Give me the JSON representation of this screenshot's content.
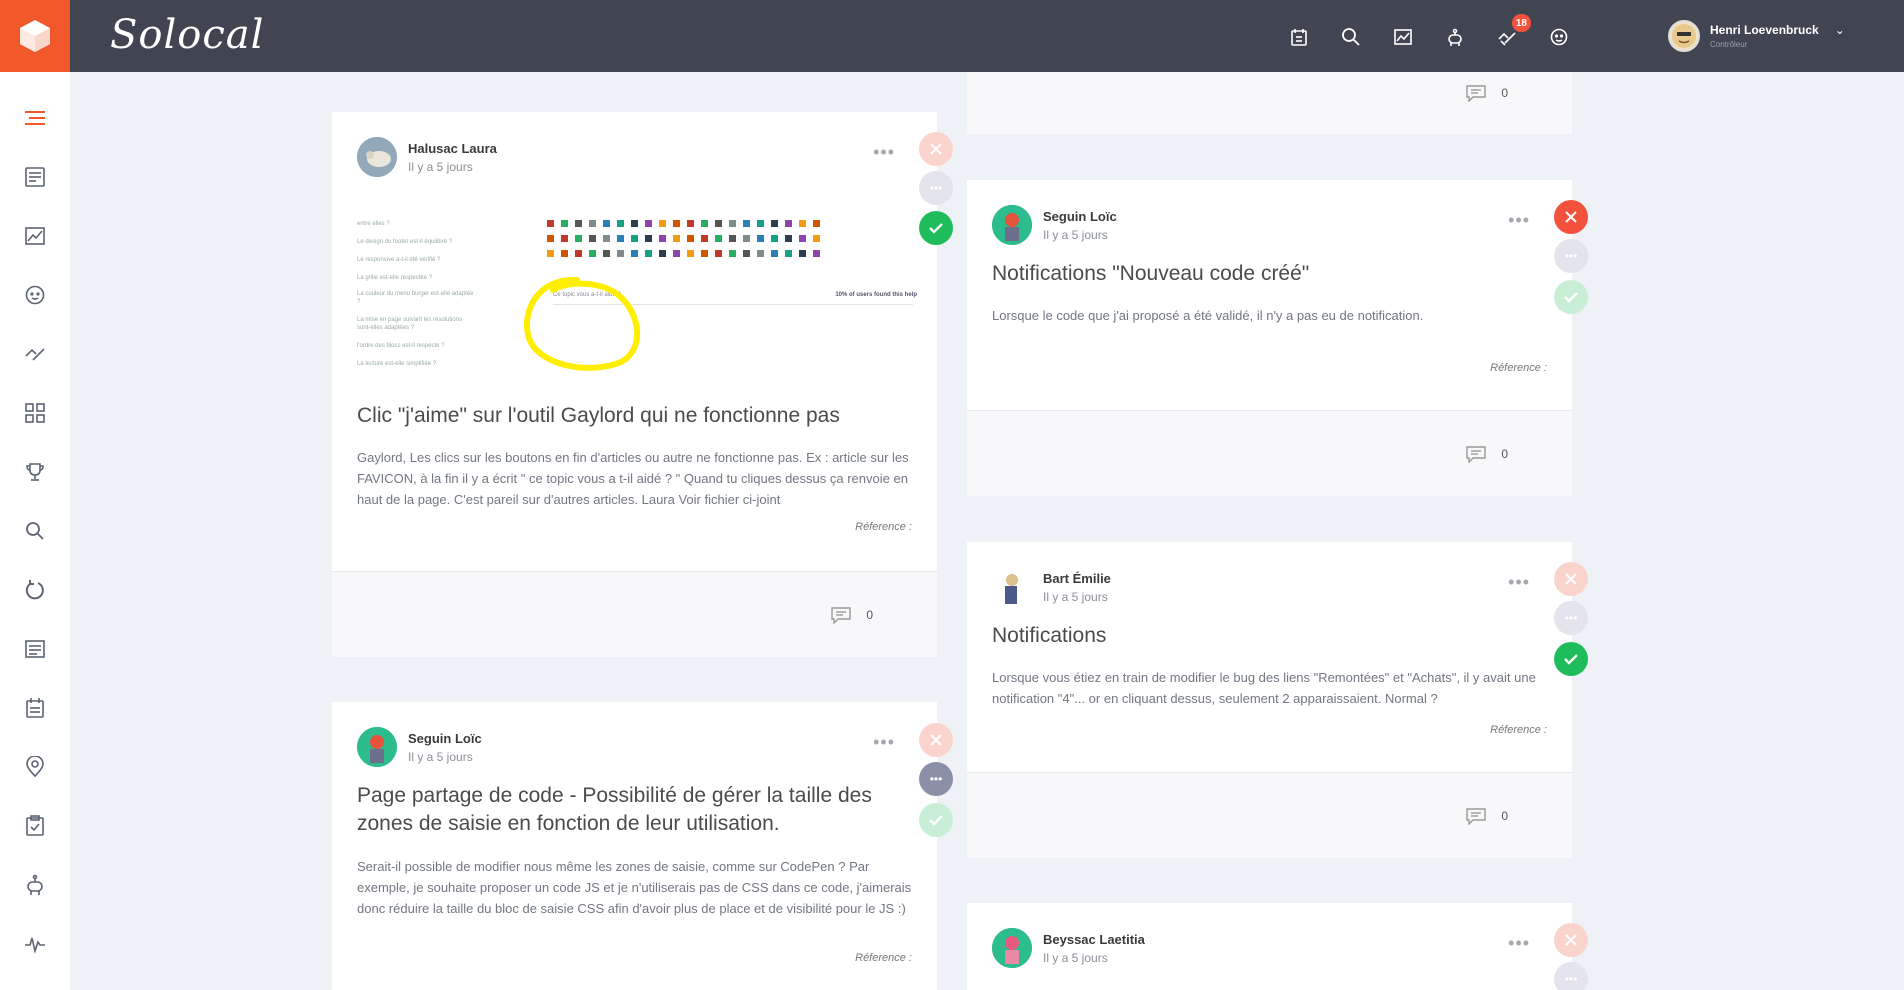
{
  "header": {
    "brand": "Solocal",
    "notification_count": "18",
    "user_name": "Henri Loevenbruck",
    "user_role": "Contrôleur",
    "icons": [
      "calendar-icon",
      "search-icon",
      "chart-icon",
      "robot-icon",
      "hands-icon",
      "face-icon"
    ]
  },
  "sidebar": {
    "items": [
      "list-icon",
      "document-icon",
      "chart-icon",
      "face-icon",
      "hands-icon",
      "grid-icon",
      "trophy-icon",
      "search-icon",
      "refresh-icon",
      "doc-lines-icon",
      "calendar-icon",
      "location-icon",
      "clipboard-check-icon",
      "robot-icon",
      "pulse-icon"
    ]
  },
  "feed": {
    "left": [
      {
        "author": "Halusac Laura",
        "date": "Il y a 5 jours",
        "title": "Clic \"j'aime\" sur l'outil Gaylord qui ne fonctionne pas",
        "desc": "Gaylord, Les clics sur les boutons en fin d'articles ou autre ne fonctionne pas. Ex : article sur les FAVICON, à la fin il y a écrit \" ce topic vous a t-il aidé ? \" Quand tu cliques dessus ça renvoie en haut de la page. C'est pareil sur d'autres articles. Laura Voir fichier ci-joint",
        "reference": "Réference :",
        "comments": "0",
        "attachment": {
          "questions": [
            "entre elles ?",
            "Le design du footer est-il équilibré ?",
            "Le responsive a-t-il été vérifié ?",
            "La grille est-elle respectée ?",
            "La couleur du menu burger est-elle adaptée ?",
            "La mise en page suivant les résolutions sont-elles adaptées ?",
            "l'ordre des blocs est-il respecté ?",
            "La lecture est-elle simplifiée ?"
          ],
          "helped_label": "Ce topic vous a-t-il aidé ?",
          "stat": "10% of users found this help"
        }
      },
      {
        "author": "Seguin Loïc",
        "date": "Il y a 5 jours",
        "title": "Page partage de code - Possibilité de gérer la taille des zones de saisie en fonction de leur utilisation.",
        "desc": "Serait-il possible de modifier nous même les zones de saisie, comme sur CodePen ? Par exemple, je souhaite proposer un code JS et je n'utiliserais pas de CSS dans ce code, j'aimerais donc réduire la taille du bloc de saisie CSS afin d'avoir plus de place et de visibilité pour le JS :)",
        "reference": "Réference :"
      }
    ],
    "right": [
      {
        "comments": "0"
      },
      {
        "author": "Seguin Loïc",
        "date": "Il y a 5 jours",
        "title": "Notifications \"Nouveau code créé\"",
        "desc": "Lorsque le code que j'ai proposé a été validé, il n'y a pas eu de notification.",
        "reference": "Réference :",
        "comments": "0"
      },
      {
        "author": "Bart Émilie",
        "date": "Il y a 5 jours",
        "title": "Notifications",
        "desc": "Lorsque vous étiez en train de modifier le bug des liens \"Remontées\" et \"Achats\", il y avait une notification \"4\"... or en cliquant dessus, seulement 2 apparaissaient. Normal ?",
        "reference": "Réference :",
        "comments": "0"
      },
      {
        "author": "Beyssac Laetitia",
        "date": "Il y a 5 jours"
      }
    ]
  },
  "colors": {
    "topbar": "#414552",
    "brand_orange": "#f1592a",
    "reject": "#f4513d",
    "pending": "#8c8fa8",
    "accept": "#1fbc5b"
  }
}
